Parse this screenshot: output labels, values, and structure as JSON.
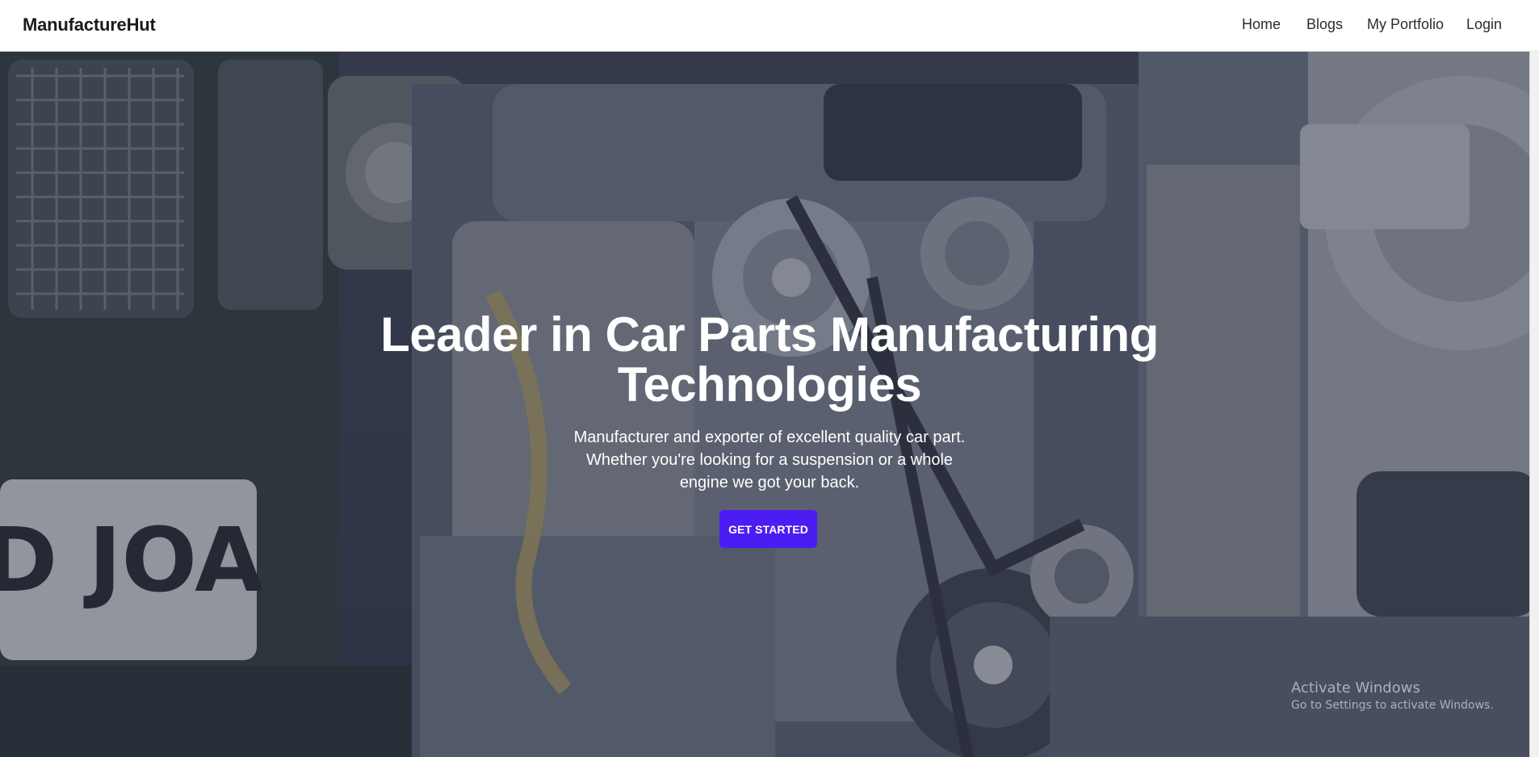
{
  "brand": "ManufactureHut",
  "nav": [
    {
      "label": "Home"
    },
    {
      "label": "Blogs"
    },
    {
      "label": "My Portfolio"
    },
    {
      "label": "Login"
    }
  ],
  "hero": {
    "title_line1": "Leader in Car Parts Manufacturing",
    "title_line2": "Technologies",
    "subtitle_line1": "Manufacturer and exporter of excellent quality car part.",
    "subtitle_line2": "Whether you're looking for a suspension or a whole",
    "subtitle_line3": "engine we got your back.",
    "cta_label": "GET STARTED",
    "plate_text": "D JOA"
  },
  "watermark": {
    "title": "Activate Windows",
    "subtitle": "Go to Settings to activate Windows."
  },
  "colors": {
    "accent": "#4c1df2",
    "navbar_bg": "#ffffff",
    "overlay": "#2d3244"
  }
}
